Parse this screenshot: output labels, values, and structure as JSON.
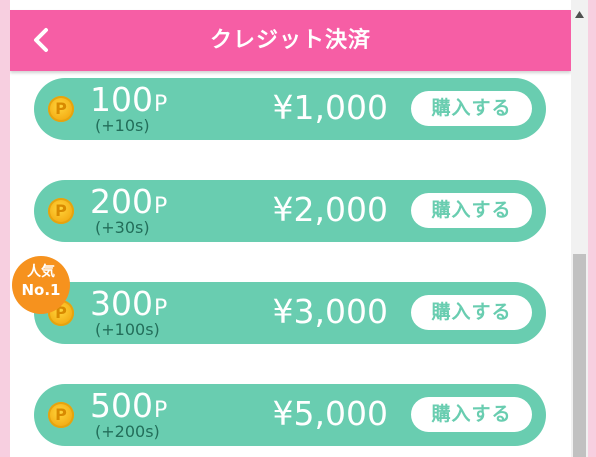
{
  "header": {
    "title": "クレジット決済",
    "back_icon": "chevron-left-icon",
    "color": "#f65ea5"
  },
  "plans": [
    {
      "points": "100",
      "unit": "P",
      "bonus": "(+10s)",
      "price": "¥1,000",
      "buy_label": "購入する"
    },
    {
      "points": "200",
      "unit": "P",
      "bonus": "(+30s)",
      "price": "¥2,000",
      "buy_label": "購入する"
    },
    {
      "points": "300",
      "unit": "P",
      "bonus": "(+100s)",
      "price": "¥3,000",
      "buy_label": "購入する"
    },
    {
      "points": "500",
      "unit": "P",
      "bonus": "(+200s)",
      "price": "¥5,000",
      "buy_label": "購入する"
    }
  ],
  "popular_badge": {
    "line1": "人気",
    "line2": "No.1",
    "color": "#f6921e"
  },
  "coin_icon": {
    "name": "coin-icon",
    "letter": "P"
  },
  "colors": {
    "plan_bg": "#69cdb0",
    "bonus_text": "#236e5a"
  }
}
